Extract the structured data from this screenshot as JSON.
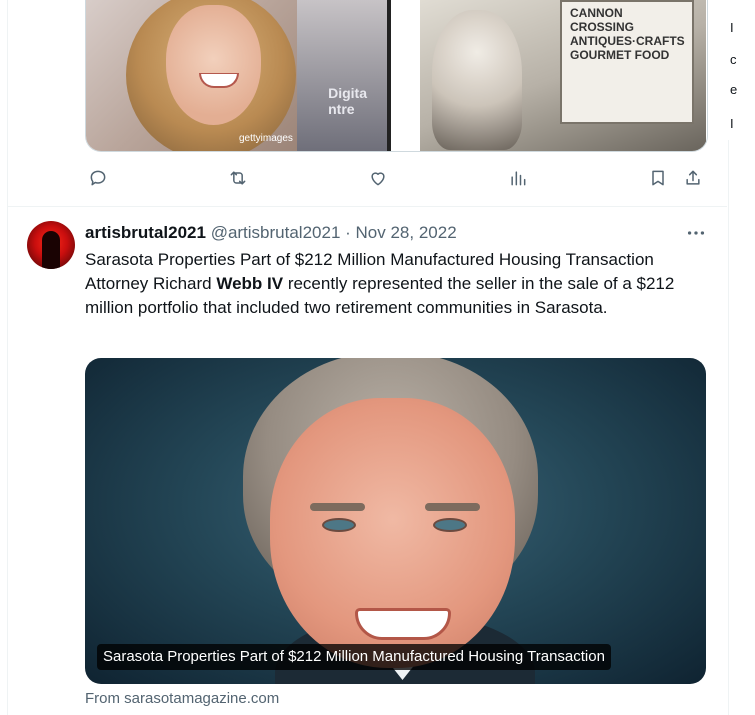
{
  "prev_tweet": {
    "media_left_watermark": "gettyimages",
    "media_left_sign": "Digita\nntre",
    "media_right_sign": "CANNON\nCROSSING\nANTIQUES·CRAFTS\nGOURMET FOOD"
  },
  "actions": {
    "reply": "reply-icon",
    "retweet": "retweet-icon",
    "like": "heart-icon",
    "views": "views-icon",
    "bookmark": "bookmark-icon",
    "share": "share-icon"
  },
  "tweet": {
    "display_name": "artisbrutal2021",
    "handle": "@artisbrutal2021",
    "dot": " · ",
    "date": "Nov 28, 2022",
    "line1": "Sarasota Properties Part of $212 Million Manufactured Housing Transaction",
    "line2_before": "Attorney Richard ",
    "line2_bold": "Webb IV",
    "line2_after": " recently represented the seller in the sale of a $212 million portfolio that included two retirement communities in Sarasota."
  },
  "card": {
    "caption": "Sarasota Properties Part of $212 Million Manufactured Housing Transaction",
    "source": "From sarasotamagazine.com"
  },
  "edge_letters": [
    "I",
    "c",
    "e",
    "I"
  ],
  "colors": {
    "text": "#0f1419",
    "muted": "#536471",
    "border": "#eff3f4"
  }
}
